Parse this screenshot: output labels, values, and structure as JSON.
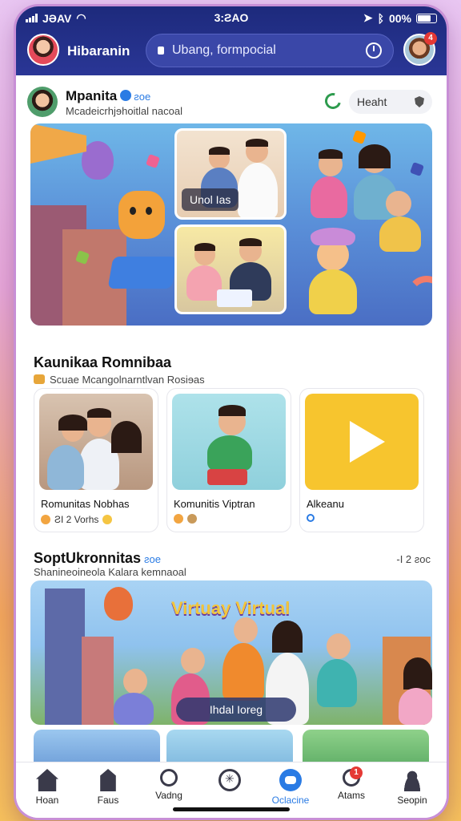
{
  "status_bar": {
    "carrier": "JƏAV",
    "time": "3:ƧAO",
    "battery": "00%"
  },
  "header": {
    "app_name": "Hibaranin",
    "search_placeholder": "Ubang, formpocial",
    "notification_count": "4"
  },
  "profile": {
    "name": "Mpanita",
    "badge": "ƨoe",
    "subtitle": "Mcadeicrhjɘhoitlal nacoal",
    "chip_label": "Heaht"
  },
  "hero": {
    "photo_label": "Unol Ias"
  },
  "section_community": {
    "title": "Kaunikaa Romnibaa",
    "subtitle": "Scuae Mcangolnarntlvan Rosiɘas",
    "cards": [
      {
        "title": "Romunitas Nobhas",
        "meta": "ƧI 2 Vorhs"
      },
      {
        "title": "Komunitis Viptran",
        "meta": ""
      },
      {
        "title": "Alkeanu",
        "meta": ""
      }
    ]
  },
  "section_virtual": {
    "title": "SoptUkronnitas",
    "tag": "ƨoe",
    "right_meta": "-I 2 ƨoc",
    "subtitle": "Shanineoineola Kalara kemnaoal",
    "banner_title": "Virtuay Virtual",
    "banner_button": "Ihdal Ioreg"
  },
  "bottom_nav": [
    {
      "label": "Hoan",
      "icon": "home-icon"
    },
    {
      "label": "Faus",
      "icon": "store-icon"
    },
    {
      "label": "Vadng",
      "icon": "search-icon"
    },
    {
      "label": "",
      "icon": "compass-icon"
    },
    {
      "label": "Oclacine",
      "icon": "chat-icon",
      "active": true
    },
    {
      "label": "Atams",
      "icon": "alert-icon",
      "badge": "1"
    },
    {
      "label": "Seopin",
      "icon": "profile-icon"
    }
  ],
  "colors": {
    "header_bg": "#1d2a7c",
    "accent": "#2a7be4",
    "badge": "#e53935"
  }
}
